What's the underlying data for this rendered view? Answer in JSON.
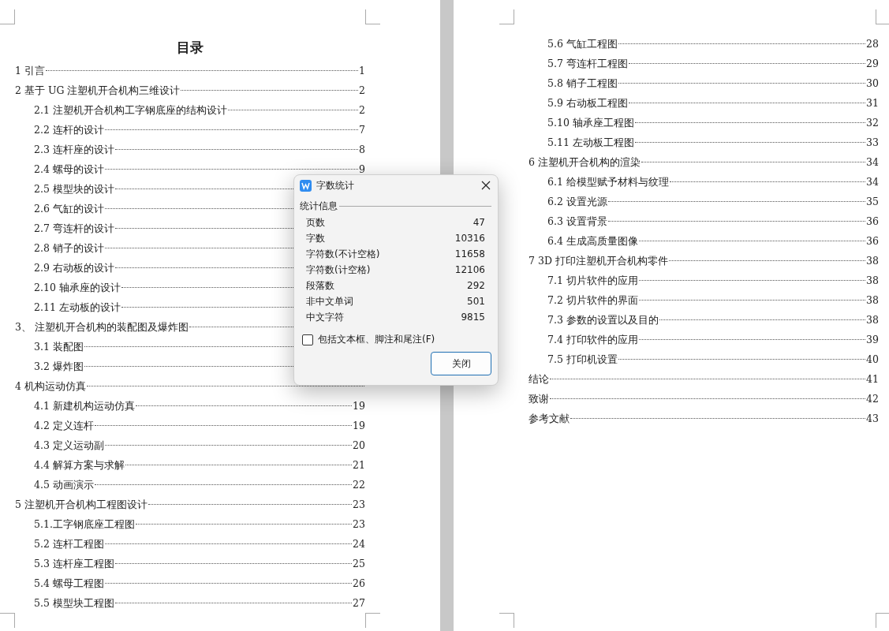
{
  "pages": [
    {
      "title": "目录",
      "entries": [
        {
          "label": "1 引言",
          "page": "1"
        },
        {
          "label": "2 基于 UG 注塑机开合机构三维设计",
          "page": "2",
          "children": [
            {
              "label": "2.1 注塑机开合机构工字钢底座的结构设计",
              "page": "2"
            },
            {
              "label": "2.2 连杆的设计",
              "page": "7"
            },
            {
              "label": "2.3 连杆座的设计",
              "page": "8"
            },
            {
              "label": "2.4 螺母的设计",
              "page": "9"
            },
            {
              "label": "2.5 模型块的设计"
            },
            {
              "label": "2.6 气缸的设计"
            },
            {
              "label": "2.7 弯连杆的设计"
            },
            {
              "label": "2.8 销子的设计"
            },
            {
              "label": "2.9 右动板的设计"
            },
            {
              "label": "2.10 轴承座的设计"
            },
            {
              "label": "2.11 左动板的设计"
            }
          ]
        },
        {
          "label": "3、 注塑机开合机构的装配图及爆炸图",
          "children": [
            {
              "label": "3.1 装配图"
            },
            {
              "label": "3.2 爆炸图"
            }
          ]
        },
        {
          "label": "4 机构运动仿真",
          "children": [
            {
              "label": "4.1 新建机构运动仿真",
              "page": "19"
            },
            {
              "label": "4.2 定义连杆",
              "page": "19"
            },
            {
              "label": "4.3 定义运动副",
              "page": "20"
            },
            {
              "label": "4.4 解算方案与求解",
              "page": "21"
            },
            {
              "label": "4.5 动画演示",
              "page": "22"
            }
          ]
        },
        {
          "label": "5 注塑机开合机构工程图设计",
          "page": "23",
          "children": [
            {
              "label": "5.1.工字钢底座工程图",
              "page": "23"
            },
            {
              "label": "5.2 连杆工程图",
              "page": "24"
            },
            {
              "label": "5.3 连杆座工程图",
              "page": "25"
            },
            {
              "label": "5.4 螺母工程图",
              "page": "26"
            },
            {
              "label": "5.5 模型块工程图",
              "page": "27"
            }
          ]
        }
      ]
    },
    {
      "continued": [
        {
          "label": "5.6 气缸工程图",
          "page": "28"
        },
        {
          "label": "5.7 弯连杆工程图",
          "page": "29"
        },
        {
          "label": "5.8 销子工程图",
          "page": "30"
        },
        {
          "label": "5.9 右动板工程图",
          "page": "31"
        },
        {
          "label": "5.10 轴承座工程图",
          "page": "32"
        },
        {
          "label": "5.11 左动板工程图",
          "page": "33"
        }
      ],
      "entries": [
        {
          "label": "6 注塑机开合机构的渲染",
          "page": "34",
          "children": [
            {
              "label": "6.1 给模型赋予材料与纹理",
              "page": "34"
            },
            {
              "label": "6.2 设置光源",
              "page": "35"
            },
            {
              "label": "6.3 设置背景",
              "page": "36"
            },
            {
              "label": "6.4 生成高质量图像",
              "page": "36"
            }
          ]
        },
        {
          "label": "7 3D 打印注塑机开合机构零件",
          "page": "38",
          "children": [
            {
              "label": "7.1 切片软件的应用",
              "page": "38"
            },
            {
              "label": "7.2 切片软件的界面",
              "page": "38"
            },
            {
              "label": "7.3 参数的设置以及目的",
              "page": "38"
            },
            {
              "label": "7.4 打印软件的应用",
              "page": "39"
            },
            {
              "label": "7.5 打印机设置",
              "page": "40"
            }
          ]
        },
        {
          "label": "结论",
          "page": "41"
        },
        {
          "label": "致谢",
          "page": "42"
        },
        {
          "label": "参考文献",
          "page": "43"
        }
      ]
    }
  ],
  "dialog": {
    "title": "字数统计",
    "group": "统计信息",
    "stats": [
      {
        "label": "页数",
        "value": "47"
      },
      {
        "label": "字数",
        "value": "10316"
      },
      {
        "label": "字符数(不计空格)",
        "value": "11658"
      },
      {
        "label": "字符数(计空格)",
        "value": "12106"
      },
      {
        "label": "段落数",
        "value": "292"
      },
      {
        "label": "非中文单词",
        "value": "501"
      },
      {
        "label": "中文字符",
        "value": "9815"
      }
    ],
    "checkbox": {
      "label": "包括文本框、脚注和尾注(F)",
      "checked": false
    },
    "button": "关闭"
  }
}
